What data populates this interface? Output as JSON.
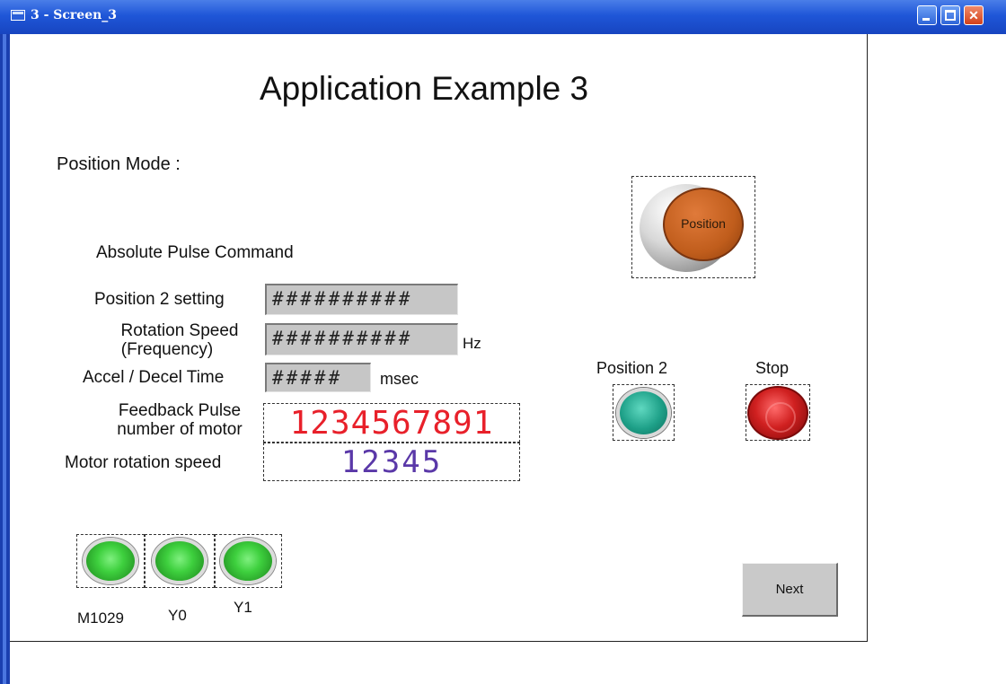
{
  "window": {
    "title": "3 - Screen_3",
    "controls": [
      "minimize",
      "maximize",
      "close"
    ]
  },
  "screen": {
    "heading": "Application Example 3",
    "mode_label": "Position Mode :",
    "section_label": "Absolute Pulse Command",
    "fields": {
      "position2_setting": {
        "label": "Position 2 setting",
        "value": "##########"
      },
      "rotation_speed": {
        "label_line1": "Rotation Speed",
        "label_line2": "(Frequency)",
        "value": "##########",
        "unit": "Hz"
      },
      "accel_decel": {
        "label": "Accel / Decel Time",
        "value": "#####",
        "unit": "msec"
      }
    },
    "displays": {
      "feedback_pulse": {
        "label_line1": "Feedback Pulse",
        "label_line2": "number of motor",
        "value": "1234567891",
        "color": "#e8202a"
      },
      "motor_speed": {
        "label": "Motor rotation speed",
        "value": "12345",
        "color": "#5a38a8"
      }
    },
    "buttons": {
      "position": "Position",
      "position2": "Position 2",
      "stop": "Stop",
      "next": "Next"
    },
    "lamps": [
      {
        "label": "M1029"
      },
      {
        "label": "Y0"
      },
      {
        "label": "Y1"
      }
    ],
    "colors": {
      "titlebar": "#1f56d8",
      "field_bg": "#c6c6c6",
      "lamp_green": "#3ed03e",
      "teal_button": "#1ea088",
      "stop_red": "#d02020",
      "position_orange": "#c05d1c"
    }
  }
}
